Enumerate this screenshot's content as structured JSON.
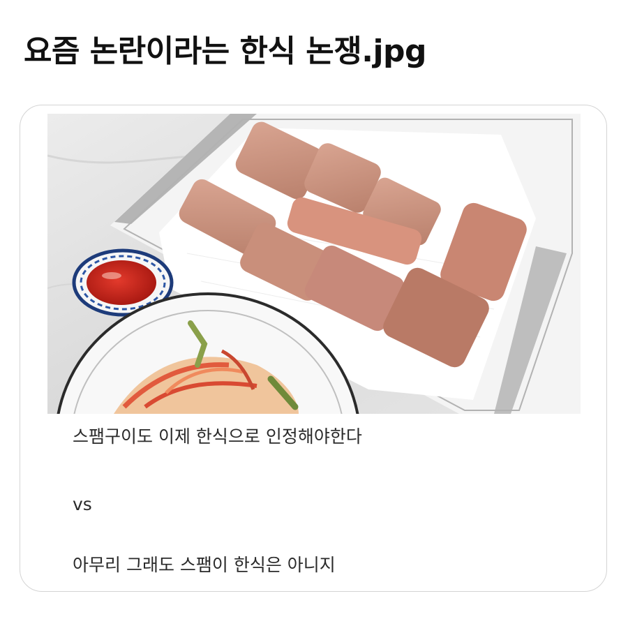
{
  "post": {
    "title": "요즘 논란이라는 한식 논쟁.jpg"
  },
  "card": {
    "photo_alt": "Plate of grilled Spam slices on paper towel with kimchi and ketchup",
    "caption_1": "스팸구이도 이제 한식으로 인정해야한다",
    "caption_2": "vs",
    "caption_3": "아무리 그래도 스팸이 한식은 아니지"
  },
  "colors": {
    "title_text": "#111111",
    "caption_text": "#2a2a2a",
    "card_border": "#d4d4d4"
  }
}
